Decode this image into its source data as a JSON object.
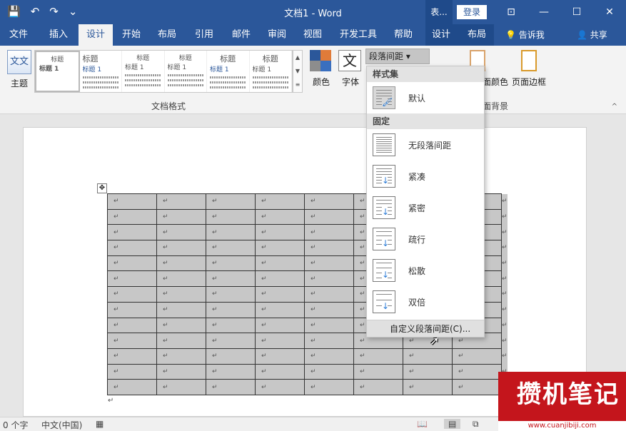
{
  "titlebar": {
    "doc_title": "文档1 - Word",
    "context_tab": "表...",
    "login": "登录",
    "qat": {
      "save": "💾",
      "undo": "↶",
      "redo": "↷",
      "customize": "⌄"
    },
    "window": {
      "ribbon_opts": "⊡",
      "minimize": "—",
      "restore": "☐",
      "close": "✕"
    }
  },
  "tabs": [
    "文件",
    "插入",
    "设计",
    "开始",
    "布局",
    "引用",
    "邮件",
    "审阅",
    "视图",
    "开发工具",
    "帮助",
    "设计",
    "布局"
  ],
  "active_tab": "设计",
  "tellme": "告诉我",
  "share": "共享",
  "ribbon": {
    "theme_label": "主题",
    "theme_glyph": "文文",
    "styles": [
      {
        "head": "标题",
        "sub": "标题 1"
      },
      {
        "head": "标题",
        "sub": "标题 1"
      },
      {
        "head": "标题",
        "sub": "标题 1"
      },
      {
        "head": "标题",
        "sub": "标题 1"
      },
      {
        "head": "标题",
        "sub": "标题 1"
      },
      {
        "head": "标题",
        "sub": "标题 1"
      }
    ],
    "group_doc_format": "文档格式",
    "colors_label": "颜色",
    "fonts_label": "字体",
    "fonts_glyph": "文",
    "para_spacing": "段落间距 ▾",
    "page_color": "面颜色",
    "page_border": "页面边框",
    "page_bg_group": "面背景"
  },
  "dropdown": {
    "styleset_header": "样式集",
    "default_label": "默认",
    "fixed_header": "固定",
    "options": [
      "无段落间距",
      "紧凑",
      "紧密",
      "疏行",
      "松散",
      "双倍"
    ],
    "custom": "自定义段落间距(C)..."
  },
  "table": {
    "rows": 13,
    "cols": 8,
    "cell_mark": "↵"
  },
  "statusbar": {
    "words": "0 个字",
    "lang": "中文(中国)"
  },
  "watermark": {
    "text": "攒机笔记",
    "url": "www.cuanjibiji.com"
  },
  "colors": {
    "accent": "#2b579a",
    "watermark": "#c4151c"
  }
}
